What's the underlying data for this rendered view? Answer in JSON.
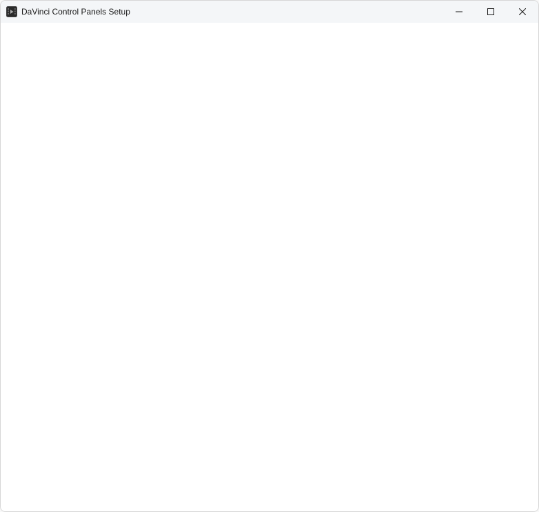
{
  "window": {
    "title": "DaVinci Control Panels Setup"
  }
}
